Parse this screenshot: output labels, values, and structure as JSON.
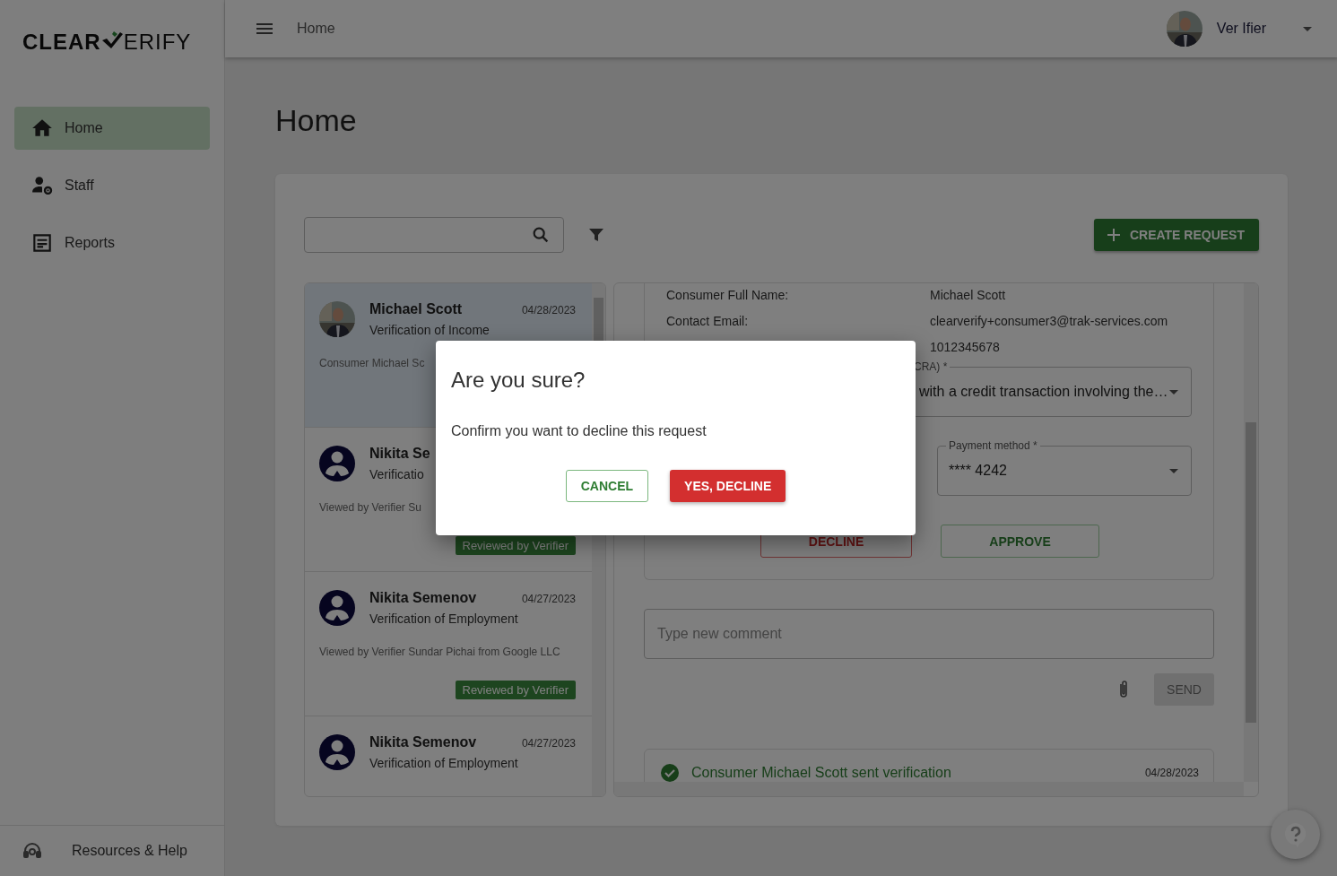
{
  "sidebar": {
    "logo": {
      "text_before": "CLEAR",
      "text_after": "ERIFY"
    },
    "items": [
      {
        "kind": "home",
        "label": "Home",
        "selected": true
      },
      {
        "kind": "staff",
        "label": "Staff",
        "selected": false
      },
      {
        "kind": "reports",
        "label": "Reports",
        "selected": false
      }
    ],
    "footer": {
      "label": "Resources & Help"
    }
  },
  "topbar": {
    "breadcrumb": "Home",
    "user": {
      "name": "Ver Ifier"
    }
  },
  "page_title": "Home",
  "toolbar": {
    "create_button": "CREATE REQUEST"
  },
  "requests": [
    {
      "name": "Michael Scott",
      "date": "04/28/2023",
      "type": "Verification of Income",
      "note": "Consumer Michael Sc",
      "selected": true
    },
    {
      "kind": "generic",
      "name": "Nikita Se",
      "type": "Verificatio",
      "note": "Viewed by Verifier Su",
      "badge": "Reviewed by Verifier",
      "selected": false
    },
    {
      "kind": "generic",
      "name": "Nikita Semenov",
      "date": "04/27/2023",
      "type": "Verification of Employment",
      "note": "Viewed by Verifier Sundar Pichai from Google LLC",
      "badge": "Reviewed by Verifier",
      "selected": false
    },
    {
      "kind": "generic",
      "name": "Nikita Semenov",
      "date": "04/27/2023",
      "type": "Verification of Employment",
      "selected": false
    }
  ],
  "details": {
    "fields": [
      {
        "label": "Consumer Full Name:",
        "value": "Michael Scott"
      },
      {
        "label": "Contact Email:",
        "value": "clearverify+consumer3@trak-services.com"
      },
      {
        "value": "1012345678"
      }
    ],
    "purpose_select": {
      "label": "CRA) *",
      "value": "with a credit transaction involving the…"
    },
    "payment_select": {
      "label": "Payment method *",
      "value": "**** 4242"
    },
    "decline_button": "DECLINE",
    "approve_button": "APPROVE",
    "comment": {
      "placeholder": "Type new comment"
    },
    "send_button": {
      "label": "SEND",
      "disabled": true
    },
    "timeline": [
      {
        "text": "Consumer Michael Scott sent verification",
        "date": "04/28/2023"
      }
    ]
  },
  "dialog": {
    "title": "Are you sure?",
    "message": "Confirm you want to decline this request",
    "cancel": "CANCEL",
    "confirm": "YES, DECLINE"
  }
}
